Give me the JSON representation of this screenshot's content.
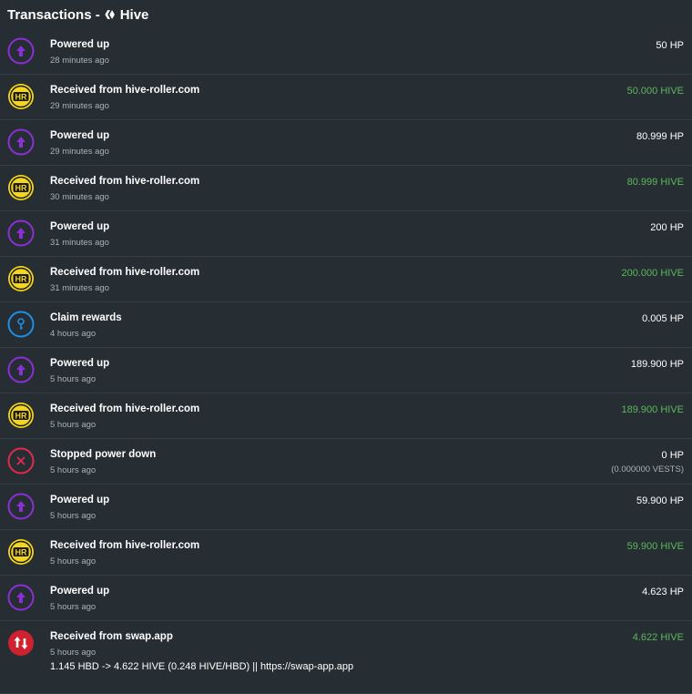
{
  "header": {
    "title": "Transactions - ",
    "coin": "Hive",
    "logo_icon": "hive-logo-icon"
  },
  "colors": {
    "background": "#262d33",
    "green": "#5cb85c",
    "purple": "#8b2fd6",
    "blue": "#1b8fe8",
    "red": "#e02b4c",
    "yellow": "#f2d51c"
  },
  "transactions": [
    {
      "type": "power-up",
      "title": "Powered up",
      "time": "28 minutes ago",
      "amount": "50 HP",
      "positive": false
    },
    {
      "type": "received",
      "title": "Received from hive-roller.com",
      "time": "29 minutes ago",
      "amount": "50.000 HIVE",
      "positive": true
    },
    {
      "type": "power-up",
      "title": "Powered up",
      "time": "29 minutes ago",
      "amount": "80.999 HP",
      "positive": false
    },
    {
      "type": "received",
      "title": "Received from hive-roller.com",
      "time": "30 minutes ago",
      "amount": "80.999 HIVE",
      "positive": true
    },
    {
      "type": "power-up",
      "title": "Powered up",
      "time": "31 minutes ago",
      "amount": "200 HP",
      "positive": false
    },
    {
      "type": "received",
      "title": "Received from hive-roller.com",
      "time": "31 minutes ago",
      "amount": "200.000 HIVE",
      "positive": true
    },
    {
      "type": "claim",
      "title": "Claim rewards",
      "time": "4 hours ago",
      "amount": "0.005 HP",
      "positive": false
    },
    {
      "type": "power-up",
      "title": "Powered up",
      "time": "5 hours ago",
      "amount": "189.900 HP",
      "positive": false
    },
    {
      "type": "received",
      "title": "Received from hive-roller.com",
      "time": "5 hours ago",
      "amount": "189.900 HIVE",
      "positive": true
    },
    {
      "type": "stop",
      "title": "Stopped power down",
      "time": "5 hours ago",
      "amount": "0 HP",
      "sub": "(0.000000 VESTS)",
      "positive": false
    },
    {
      "type": "power-up",
      "title": "Powered up",
      "time": "5 hours ago",
      "amount": "59.900 HP",
      "positive": false
    },
    {
      "type": "received",
      "title": "Received from hive-roller.com",
      "time": "5 hours ago",
      "amount": "59.900 HIVE",
      "positive": true
    },
    {
      "type": "power-up",
      "title": "Powered up",
      "time": "5 hours ago",
      "amount": "4.623 HP",
      "positive": false
    },
    {
      "type": "swap",
      "title": "Received from swap.app",
      "time": "5 hours ago",
      "amount": "4.622 HIVE",
      "positive": true,
      "memo": "1.145 HBD -> 4.622 HIVE (0.248 HIVE/HBD) || https://swap-app.app"
    }
  ]
}
